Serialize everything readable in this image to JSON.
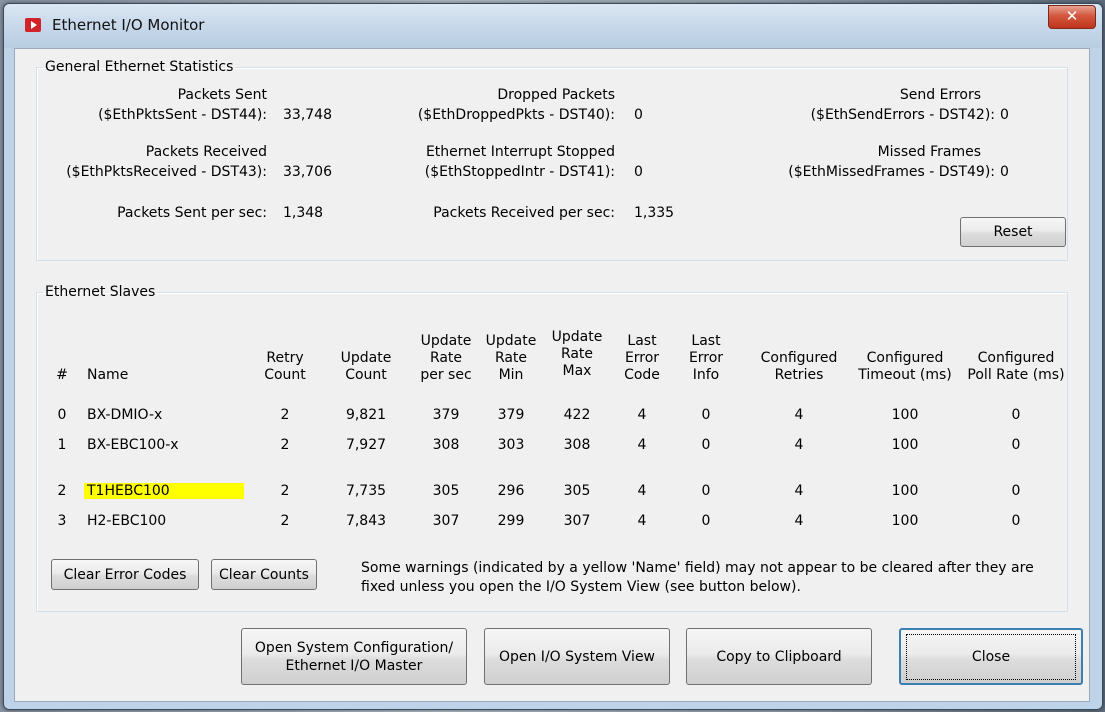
{
  "window": {
    "title": "Ethernet I/O Monitor",
    "close_glyph": "✕"
  },
  "stats": {
    "group_label": "General Ethernet Statistics",
    "packets_sent": {
      "line1": "Packets Sent",
      "line2": "($EthPktsSent - DST44):",
      "value": "33,748"
    },
    "packets_received": {
      "line1": "Packets Received",
      "line2": "($EthPktsReceived - DST43):",
      "value": "33,706"
    },
    "sent_per_sec": {
      "label": "Packets Sent per sec:",
      "value": "1,348"
    },
    "dropped": {
      "line1": "Dropped Packets",
      "line2": "($EthDroppedPkts - DST40):",
      "value": "0"
    },
    "interrupt": {
      "line1": "Ethernet Interrupt Stopped",
      "line2": "($EthStoppedIntr - DST41):",
      "value": "0"
    },
    "received_per_sec": {
      "label": "Packets Received per sec:",
      "value": "1,335"
    },
    "send_errors": {
      "line1": "Send Errors",
      "line2": "($EthSendErrors - DST42):",
      "value": "0"
    },
    "missed_frames": {
      "line1": "Missed Frames",
      "line2": "($EthMissedFrames - DST49):",
      "value": "0"
    },
    "reset_label": "Reset"
  },
  "slaves": {
    "group_label": "Ethernet Slaves",
    "columns": {
      "num": "#",
      "name": "Name",
      "retry": [
        "Retry",
        "Count"
      ],
      "update": [
        "Update",
        "Count"
      ],
      "rate": [
        "Update",
        "Rate",
        "per sec"
      ],
      "min": [
        "Update",
        "Rate",
        "Min"
      ],
      "max": [
        "Update",
        "Rate",
        "Max"
      ],
      "ecode": [
        "Last",
        "Error",
        "Code"
      ],
      "einfo": [
        "Last",
        "Error",
        "Info"
      ],
      "retries": [
        "Configured",
        "Retries"
      ],
      "timeout": [
        "Configured",
        "Timeout (ms)"
      ],
      "poll": [
        "Configured",
        "Poll Rate (ms)"
      ]
    },
    "rows": [
      {
        "num": "0",
        "name": "BX-DMIO-x",
        "warning": false,
        "retry": "2",
        "update": "9,821",
        "rate": "379",
        "min": "379",
        "max": "422",
        "ecode": "4",
        "einfo": "0",
        "retries": "4",
        "timeout": "100",
        "poll": "0"
      },
      {
        "num": "1",
        "name": "BX-EBC100-x",
        "warning": false,
        "retry": "2",
        "update": "7,927",
        "rate": "308",
        "min": "303",
        "max": "308",
        "ecode": "4",
        "einfo": "0",
        "retries": "4",
        "timeout": "100",
        "poll": "0"
      },
      {
        "num": "2",
        "name": "T1HEBC100",
        "warning": true,
        "retry": "2",
        "update": "7,735",
        "rate": "305",
        "min": "296",
        "max": "305",
        "ecode": "4",
        "einfo": "0",
        "retries": "4",
        "timeout": "100",
        "poll": "0"
      },
      {
        "num": "3",
        "name": "H2-EBC100",
        "warning": false,
        "retry": "2",
        "update": "7,843",
        "rate": "307",
        "min": "299",
        "max": "307",
        "ecode": "4",
        "einfo": "0",
        "retries": "4",
        "timeout": "100",
        "poll": "0"
      }
    ],
    "clear_error_codes_label": "Clear Error Codes",
    "clear_counts_label": "Clear Counts",
    "note_line1": "Some warnings (indicated by a yellow 'Name' field) may not appear to be cleared after they are",
    "note_line2": "fixed unless you open the I/O System View (see button below)."
  },
  "footer": {
    "open_config_line1": "Open System Configuration/",
    "open_config_line2": "Ethernet I/O Master",
    "open_io_view": "Open I/O System View",
    "copy_clipboard": "Copy to Clipboard",
    "close": "Close"
  },
  "colors": {
    "warning_highlight": "#ffff00",
    "title_close": "#c0341c",
    "app_icon": "#d2232a"
  }
}
